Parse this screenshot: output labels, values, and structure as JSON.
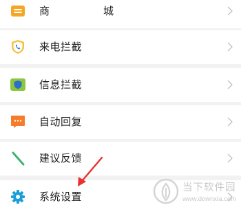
{
  "menu": {
    "items": [
      {
        "label": "商　　城",
        "icon": "shop-icon",
        "color": "#f5a623"
      },
      {
        "label": "来电拦截",
        "icon": "call-block-shield-icon",
        "color": "#f7c23a"
      },
      {
        "label": "信息拦截",
        "icon": "message-block-shield-icon",
        "color": "#8cc63f"
      },
      {
        "label": "自动回复",
        "icon": "auto-reply-chat-icon",
        "color": "#f57c2a"
      },
      {
        "label": "建议反馈",
        "icon": "feedback-pen-icon",
        "color": "#3cb371"
      },
      {
        "label": "系统设置",
        "icon": "settings-gear-icon",
        "color": "#1a9fd8"
      }
    ]
  },
  "watermark": {
    "title": "当下软件园",
    "url": "www.downxia.com"
  },
  "annotation": {
    "arrow_color": "#e8312f"
  }
}
